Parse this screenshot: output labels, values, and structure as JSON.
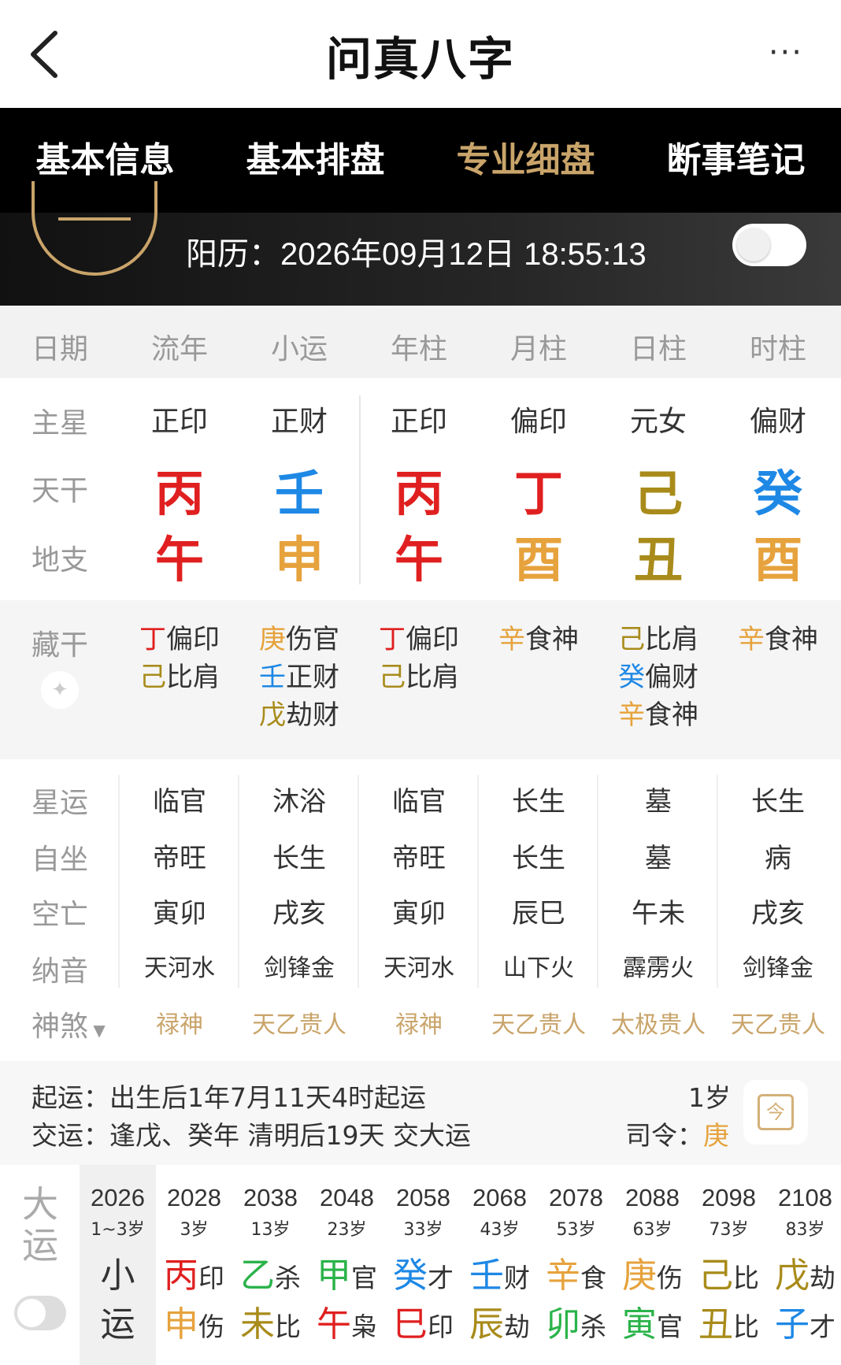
{
  "header": {
    "title": "问真八字",
    "more_label": "···"
  },
  "tabs": [
    "基本信息",
    "基本排盘",
    "专业细盘",
    "断事笔记"
  ],
  "date_bar": {
    "solar_text": "阳历：2026年09月12日 18:55:13"
  },
  "columns": [
    "日期",
    "流年",
    "小运",
    "年柱",
    "月柱",
    "日柱",
    "时柱"
  ],
  "row_labels": {
    "main_star": "主星",
    "heavenly_stem": "天干",
    "earthly_branch": "地支",
    "hidden_stem": "藏干",
    "star_fortune": "星运",
    "self_seat": "自坐",
    "void": "空亡",
    "nayin": "纳音",
    "shensha": "神煞"
  },
  "colors": {
    "fire": "#e02020",
    "water": "#1e88e5",
    "metal": "#e6a23c",
    "earth": "#a88b1a",
    "wood": "#2bb34a",
    "gold_accent": "#c9a46a"
  },
  "main_stars": [
    "正印",
    "正财",
    "正印",
    "偏印",
    "元女",
    "偏财"
  ],
  "stems": [
    {
      "char": "丙",
      "color": "#e02020"
    },
    {
      "char": "壬",
      "color": "#1e88e5"
    },
    {
      "char": "丙",
      "color": "#e02020"
    },
    {
      "char": "丁",
      "color": "#e02020"
    },
    {
      "char": "己",
      "color": "#a88b1a"
    },
    {
      "char": "癸",
      "color": "#1e88e5"
    }
  ],
  "branches": [
    {
      "char": "午",
      "color": "#e02020"
    },
    {
      "char": "申",
      "color": "#e6a23c"
    },
    {
      "char": "午",
      "color": "#e02020"
    },
    {
      "char": "酉",
      "color": "#e6a23c"
    },
    {
      "char": "丑",
      "color": "#a88b1a"
    },
    {
      "char": "酉",
      "color": "#e6a23c"
    }
  ],
  "hidden_stems": [
    [
      {
        "stem": "丁",
        "color": "#e02020",
        "god": "偏印"
      },
      {
        "stem": "己",
        "color": "#a88b1a",
        "god": "比肩"
      }
    ],
    [
      {
        "stem": "庚",
        "color": "#e6a23c",
        "god": "伤官"
      },
      {
        "stem": "壬",
        "color": "#1e88e5",
        "god": "正财"
      },
      {
        "stem": "戊",
        "color": "#a88b1a",
        "god": "劫财"
      }
    ],
    [
      {
        "stem": "丁",
        "color": "#e02020",
        "god": "偏印"
      },
      {
        "stem": "己",
        "color": "#a88b1a",
        "god": "比肩"
      }
    ],
    [
      {
        "stem": "辛",
        "color": "#e6a23c",
        "god": "食神"
      }
    ],
    [
      {
        "stem": "己",
        "color": "#a88b1a",
        "god": "比肩"
      },
      {
        "stem": "癸",
        "color": "#1e88e5",
        "god": "偏财"
      },
      {
        "stem": "辛",
        "color": "#e6a23c",
        "god": "食神"
      }
    ],
    [
      {
        "stem": "辛",
        "color": "#e6a23c",
        "god": "食神"
      }
    ]
  ],
  "star_fortune": [
    "临官",
    "沐浴",
    "临官",
    "长生",
    "墓",
    "长生"
  ],
  "self_seat": [
    "帝旺",
    "长生",
    "帝旺",
    "长生",
    "墓",
    "病"
  ],
  "void": [
    "寅卯",
    "戌亥",
    "寅卯",
    "辰巳",
    "午未",
    "戌亥"
  ],
  "nayin": [
    "天河水",
    "剑锋金",
    "天河水",
    "山下火",
    "霹雳火",
    "剑锋金"
  ],
  "shensha": [
    "禄神",
    "天乙贵人",
    "禄神",
    "天乙贵人",
    "太极贵人",
    "天乙贵人"
  ],
  "qiyun": {
    "line1_label": "起运：",
    "line1_text": "出生后1年7月11天4时起运",
    "line2_label": "交运：",
    "line2_text": "逢戊、癸年 清明后19天 交大运",
    "age": "1岁",
    "siling_label": "司令：",
    "siling_value": "庚",
    "today_icon": "calendar-today-icon",
    "today_label": "今"
  },
  "dayun": {
    "label": "大运",
    "xiaoyun": {
      "year": "2026",
      "age": "1~3岁",
      "line1": "小",
      "line2": "运"
    },
    "items": [
      {
        "year": "2028",
        "age": "3岁",
        "stem": "丙",
        "stem_color": "#e02020",
        "stem_god": "印",
        "branch": "申",
        "branch_color": "#e6a23c",
        "branch_god": "伤"
      },
      {
        "year": "2038",
        "age": "13岁",
        "stem": "乙",
        "stem_color": "#2bb34a",
        "stem_god": "杀",
        "branch": "未",
        "branch_color": "#a88b1a",
        "branch_god": "比"
      },
      {
        "year": "2048",
        "age": "23岁",
        "stem": "甲",
        "stem_color": "#2bb34a",
        "stem_god": "官",
        "branch": "午",
        "branch_color": "#e02020",
        "branch_god": "枭"
      },
      {
        "year": "2058",
        "age": "33岁",
        "stem": "癸",
        "stem_color": "#1e88e5",
        "stem_god": "才",
        "branch": "巳",
        "branch_color": "#e02020",
        "branch_god": "印"
      },
      {
        "year": "2068",
        "age": "43岁",
        "stem": "壬",
        "stem_color": "#1e88e5",
        "stem_god": "财",
        "branch": "辰",
        "branch_color": "#a88b1a",
        "branch_god": "劫"
      },
      {
        "year": "2078",
        "age": "53岁",
        "stem": "辛",
        "stem_color": "#e6a23c",
        "stem_god": "食",
        "branch": "卯",
        "branch_color": "#2bb34a",
        "branch_god": "杀"
      },
      {
        "year": "2088",
        "age": "63岁",
        "stem": "庚",
        "stem_color": "#e6a23c",
        "stem_god": "伤",
        "branch": "寅",
        "branch_color": "#2bb34a",
        "branch_god": "官"
      },
      {
        "year": "2098",
        "age": "73岁",
        "stem": "己",
        "stem_color": "#a88b1a",
        "stem_god": "比",
        "branch": "丑",
        "branch_color": "#a88b1a",
        "branch_god": "比"
      },
      {
        "year": "2108",
        "age": "83岁",
        "stem": "戊",
        "stem_color": "#a88b1a",
        "stem_god": "劫",
        "branch": "子",
        "branch_color": "#1e88e5",
        "branch_god": "才"
      }
    ]
  }
}
